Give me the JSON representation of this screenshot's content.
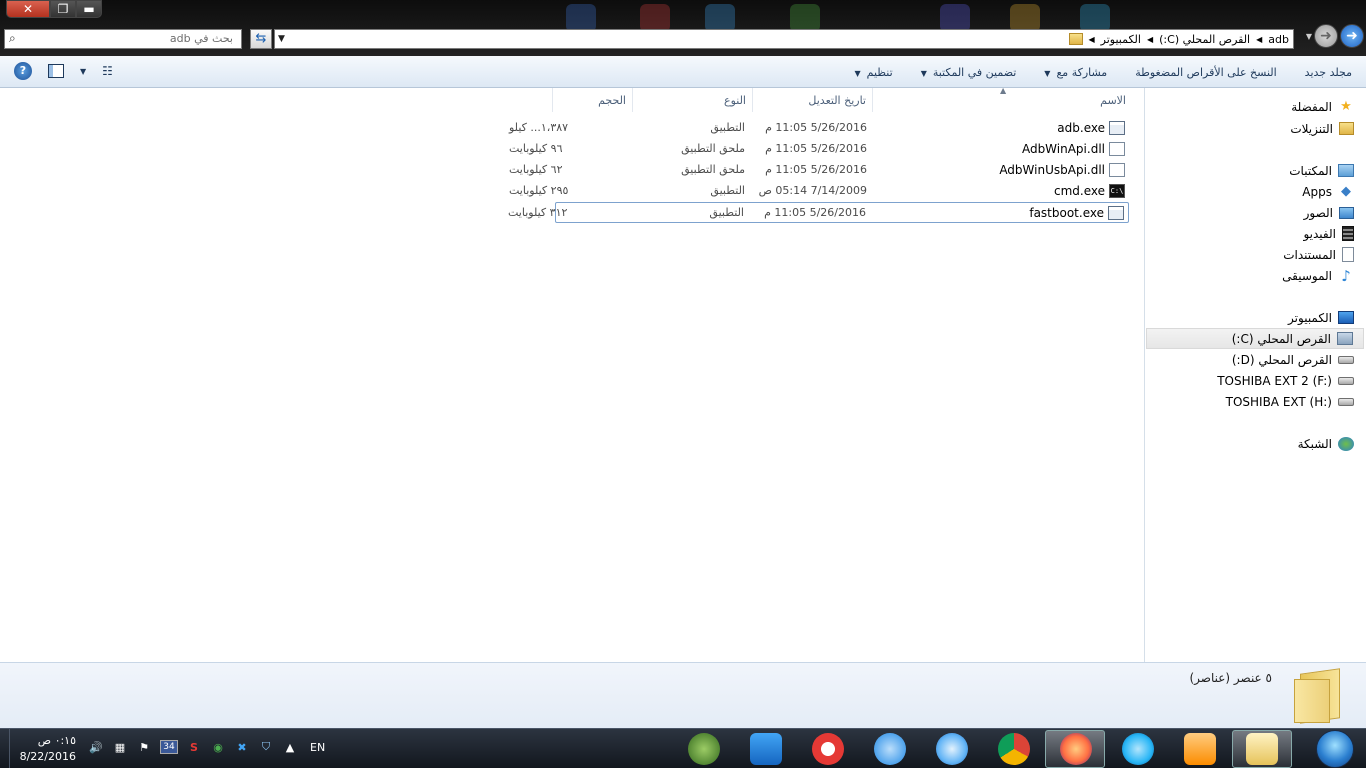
{
  "window": {
    "close_label": "✕",
    "max_label": "❐",
    "min_label": "▬"
  },
  "search": {
    "placeholder": "بحث في adb"
  },
  "address": {
    "crumbs": [
      "الكمبيوتر",
      "القرص المحلي (C:)",
      "adb"
    ]
  },
  "toolbar": {
    "organize": "تنظيم",
    "include_in_library": "تضمين في المكتبة",
    "share_with": "مشاركة مع",
    "burn": "النسخ على الأقراص المضغوطة",
    "new_folder": "مجلد جديد"
  },
  "columns": {
    "name": "الاسم",
    "date_modified": "تاريخ التعديل",
    "type": "النوع",
    "size": "الحجم"
  },
  "files": [
    {
      "name": "adb.exe",
      "date": "5/26/2016 11:05 م",
      "type": "التطبيق",
      "size": "١،٣٨٧... كيلو",
      "icon": "exe-icon"
    },
    {
      "name": "AdbWinApi.dll",
      "date": "5/26/2016 11:05 م",
      "type": "ملحق التطبيق",
      "size": "٩٦ كيلوبايت",
      "icon": "dll-icon"
    },
    {
      "name": "AdbWinUsbApi.dll",
      "date": "5/26/2016 11:05 م",
      "type": "ملحق التطبيق",
      "size": "٦٢ كيلوبايت",
      "icon": "dll-icon"
    },
    {
      "name": "cmd.exe",
      "date": "7/14/2009 05:14 ص",
      "type": "التطبيق",
      "size": "٢٩٥ كيلوبايت",
      "icon": "cmd-icon"
    },
    {
      "name": "fastboot.exe",
      "date": "5/26/2016 11:05 م",
      "type": "التطبيق",
      "size": "٣١٢ كيلوبايت",
      "icon": "exe-icon"
    }
  ],
  "nav": {
    "favorites": "المفضلة",
    "downloads": "التنزيلات",
    "libraries": "المكتبات",
    "apps": "Apps",
    "pictures": "الصور",
    "videos": "الفيديو",
    "documents": "المستندات",
    "music": "الموسيقى",
    "computer": "الكمبيوتر",
    "drive_c": "القرص المحلي (C:)",
    "drive_d": "القرص المحلي (D:)",
    "drive_f": "TOSHIBA EXT 2 (F:)",
    "drive_h": "TOSHIBA EXT (H:)",
    "network": "الشبكة"
  },
  "details": {
    "item_count": "٥ عنصر (عناصر)"
  },
  "taskbar": {
    "time": "٠:١٥ ص",
    "date": "8/22/2016",
    "language": "EN",
    "tray_badge": "34",
    "colors": {
      "utorrent": "#4caf50",
      "maxthon": "#1e88e5",
      "opera": "#e53935",
      "safari": "#64b5f6",
      "chrome": "#f4b400",
      "firefox": "#ff7043",
      "ie": "#29b6f6",
      "media": "#fb8c00"
    }
  }
}
